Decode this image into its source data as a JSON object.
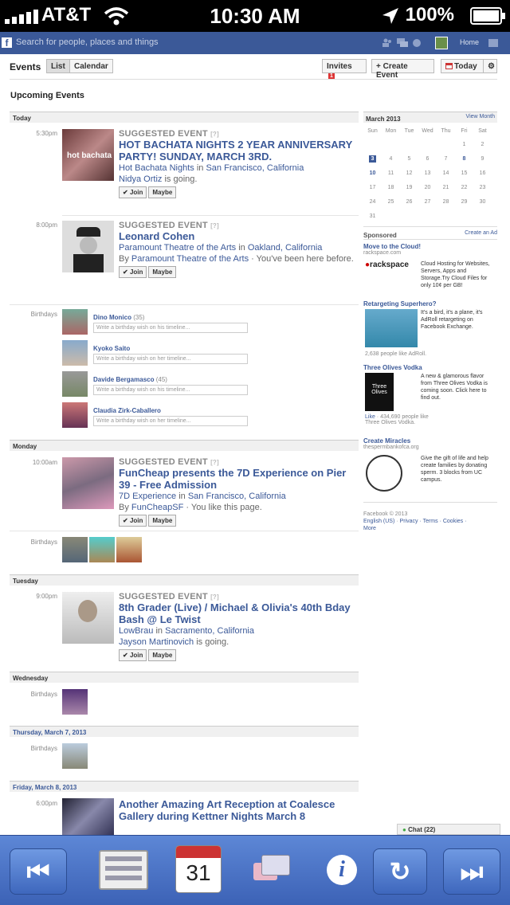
{
  "status": {
    "carrier": "AT&T",
    "time": "10:30 AM",
    "battery": "100%"
  },
  "fb": {
    "search_placeholder": "Search for people, places and things",
    "home": "Home"
  },
  "header": {
    "title": "Events",
    "list": "List",
    "calendar": "Calendar",
    "invites": "Invites",
    "invites_count": "1",
    "create": "+ Create Event",
    "today": "Today"
  },
  "section_title": "Upcoming Events",
  "days": {
    "today": "Today",
    "monday": "Monday",
    "tuesday": "Tuesday",
    "wednesday": "Wednesday",
    "thursday": "Thursday, March 7, 2013",
    "friday": "Friday, March 8, 2013"
  },
  "labels": {
    "suggested": "SUGGESTED EVENT",
    "birthdays": "Birthdays",
    "join": "Join",
    "maybe": "Maybe",
    "wish_his": "Write a birthday wish on his timeline...",
    "wish_her": "Write a birthday wish on her timeline..."
  },
  "events": [
    {
      "time": "5:30pm",
      "title": "HOT BACHATA NIGHTS 2 YEAR ANNIVERSARY PARTY! SUNDAY, MARCH 3RD.",
      "host": "Hot Bachata Nights",
      "in": " in ",
      "place": "San Francisco, California",
      "line3a": "Nidya Ortiz",
      "line3b": " is going.",
      "thumb_text": "hot bachata"
    },
    {
      "time": "8:00pm",
      "title": "Leonard Cohen",
      "host": "Paramount Theatre of the Arts",
      "in": " in ",
      "place": "Oakland, California",
      "line3pre": "By ",
      "line3a": "Paramount Theatre of the Arts",
      "line3b": " · You've been here before."
    },
    {
      "time": "10:00am",
      "title": "FunCheap presents the 7D Experience on Pier 39 - Free Admission",
      "host": "7D Experience",
      "in": " in ",
      "place": "San Francisco, California",
      "line3pre": "By ",
      "line3a": "FunCheapSF",
      "line3b": " · You like this page."
    },
    {
      "time": "9:00pm",
      "title": "8th Grader (Live) / Michael & Olivia's 40th Bday Bash @ Le Twist",
      "host": "LowBrau",
      "in": " in ",
      "place": "Sacramento, California",
      "line3a": "Jayson Martinovich",
      "line3b": " is going."
    },
    {
      "time": "6:00pm",
      "title": "Another Amazing Art Reception at Coalesce Gallery during Kettner Nights March 8"
    }
  ],
  "birthdays": [
    {
      "name": "Dino Monico",
      "age": "(35)"
    },
    {
      "name": "Kyoko Saito",
      "age": ""
    },
    {
      "name": "Davide Bergamasco",
      "age": "(45)"
    },
    {
      "name": "Claudia Zirk-Caballero",
      "age": ""
    }
  ],
  "calendar": {
    "month": "March 2013",
    "view": "View Month",
    "weekdays": [
      "Sun",
      "Mon",
      "Tue",
      "Wed",
      "Thu",
      "Fri",
      "Sat"
    ],
    "weeks": [
      [
        "",
        "",
        "",
        "",
        "",
        "1",
        "2"
      ],
      [
        "3",
        "4",
        "5",
        "6",
        "7",
        "8",
        "9"
      ],
      [
        "10",
        "11",
        "12",
        "13",
        "14",
        "15",
        "16"
      ],
      [
        "17",
        "18",
        "19",
        "20",
        "21",
        "22",
        "23"
      ],
      [
        "24",
        "25",
        "26",
        "27",
        "28",
        "29",
        "30"
      ],
      [
        "31",
        "",
        "",
        "",
        "",
        "",
        ""
      ]
    ]
  },
  "ads": {
    "sponsored": "Sponsored",
    "create_ad": "Create an Ad",
    "items": [
      {
        "title": "Move to the Cloud!",
        "sub": "rackspace.com",
        "text": "Cloud Hosting for Websites, Servers, Apps and Storage.Try Cloud Files for only 10¢ per GB!",
        "logo": "rackspace"
      },
      {
        "title": "Retargeting Superhero?",
        "text": "It's a bird, it's a plane, it's AdRoll retargeting on Facebook Exchange.",
        "foot": "2,638 people like AdRoll."
      },
      {
        "title": "Three Olives Vodka",
        "text": "A new & glamorous flavor from Three Olives Vodka is coming soon. Click here to find out.",
        "like": "Like",
        "foot1": " · 434,690 people like",
        "foot2": "Three Olives Vodka.",
        "logo": "Three Olives"
      },
      {
        "title": "Create Miracles",
        "sub": "thespermbankofca.org",
        "text": "Give the gift of life and help create families by donating sperm. 3 blocks from UC campus."
      }
    ]
  },
  "footer": {
    "copy": "Facebook © 2013",
    "lang": "English (US)",
    "links": "Privacy · Terms · Cookies ·",
    "more": "More"
  },
  "chat": "Chat (22)",
  "toolbar": {
    "calendar_day": "31"
  }
}
